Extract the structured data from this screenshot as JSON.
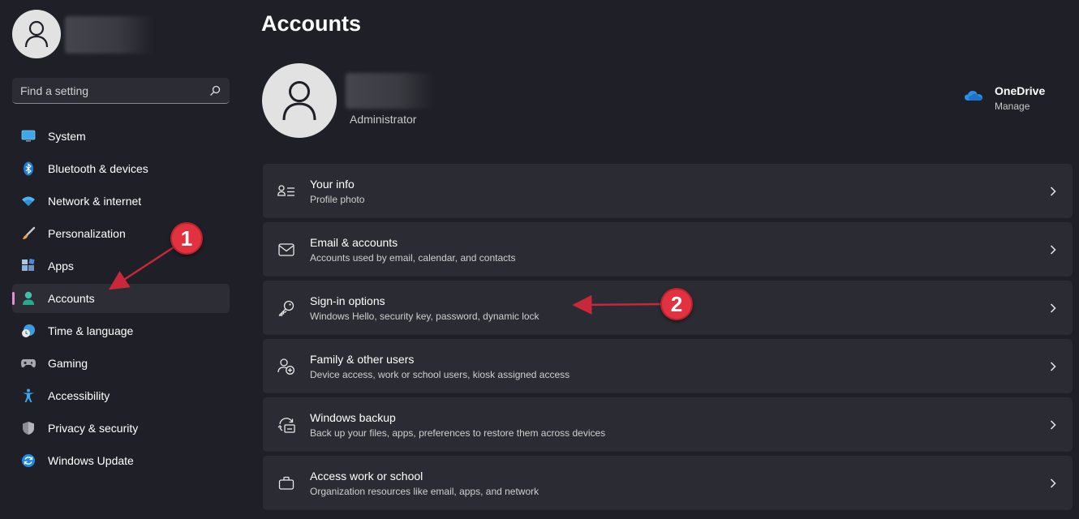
{
  "sidebar": {
    "search": {
      "placeholder": "Find a setting",
      "value": ""
    },
    "items": [
      {
        "label": "System",
        "icon": "monitor-icon",
        "active": false
      },
      {
        "label": "Bluetooth & devices",
        "icon": "bluetooth-icon",
        "active": false
      },
      {
        "label": "Network & internet",
        "icon": "wifi-icon",
        "active": false
      },
      {
        "label": "Personalization",
        "icon": "brush-icon",
        "active": false
      },
      {
        "label": "Apps",
        "icon": "apps-icon",
        "active": false
      },
      {
        "label": "Accounts",
        "icon": "person-icon",
        "active": true
      },
      {
        "label": "Time & language",
        "icon": "clock-globe-icon",
        "active": false
      },
      {
        "label": "Gaming",
        "icon": "gamepad-icon",
        "active": false
      },
      {
        "label": "Accessibility",
        "icon": "accessibility-icon",
        "active": false
      },
      {
        "label": "Privacy & security",
        "icon": "shield-icon",
        "active": false
      },
      {
        "label": "Windows Update",
        "icon": "refresh-icon",
        "active": false
      }
    ]
  },
  "main": {
    "title": "Accounts",
    "profile": {
      "role": "Administrator"
    },
    "onedrive": {
      "title": "OneDrive",
      "subtitle": "Manage"
    },
    "cards": [
      {
        "title": "Your info",
        "subtitle": "Profile photo",
        "icon": "person-card-icon"
      },
      {
        "title": "Email & accounts",
        "subtitle": "Accounts used by email, calendar, and contacts",
        "icon": "mail-icon"
      },
      {
        "title": "Sign-in options",
        "subtitle": "Windows Hello, security key, password, dynamic lock",
        "icon": "key-icon"
      },
      {
        "title": "Family & other users",
        "subtitle": "Device access, work or school users, kiosk assigned access",
        "icon": "add-person-icon"
      },
      {
        "title": "Windows backup",
        "subtitle": "Back up your files, apps, preferences to restore them across devices",
        "icon": "backup-icon"
      },
      {
        "title": "Access work or school",
        "subtitle": "Organization resources like email, apps, and network",
        "icon": "briefcase-icon"
      }
    ]
  },
  "annotations": [
    {
      "label": "1"
    },
    {
      "label": "2"
    }
  ],
  "colors": {
    "background": "#1f2027",
    "card": "#2b2c33",
    "active_indicator": "#e58fcf",
    "badge": "#e2323f",
    "arrow": "#c8283a"
  }
}
